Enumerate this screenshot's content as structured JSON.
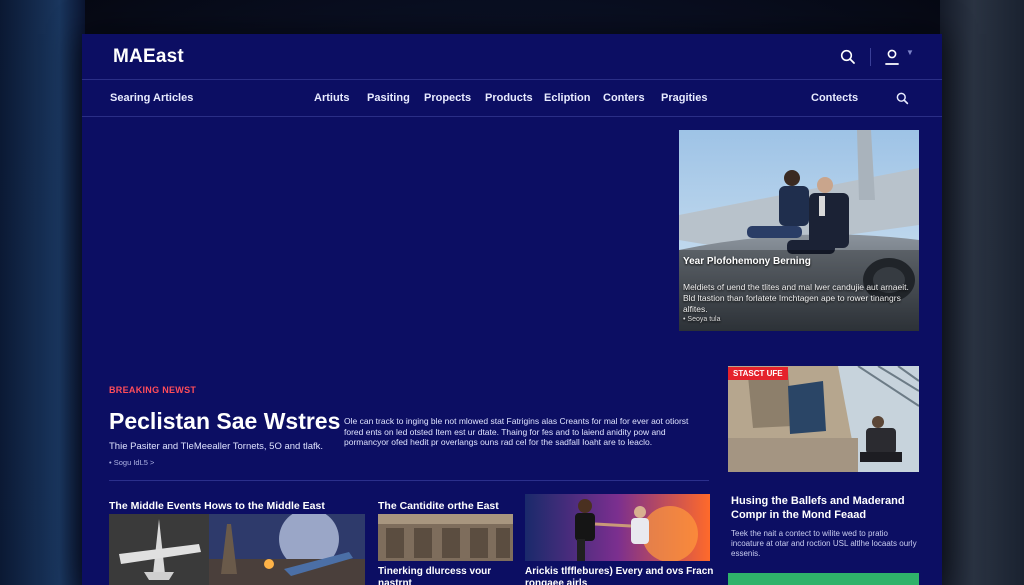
{
  "header": {
    "logo": "MAEast"
  },
  "nav": {
    "items": [
      {
        "label": "Searing Articles"
      },
      {
        "label": "Artiuts"
      },
      {
        "label": "Pasiting"
      },
      {
        "label": "Propects"
      },
      {
        "label": "Products"
      },
      {
        "label": "Ecliption"
      },
      {
        "label": "Conters"
      },
      {
        "label": "Pragities"
      },
      {
        "label": "Contects"
      }
    ]
  },
  "hero": {
    "title": "Year Plofohemony Berning",
    "description": "Meldiets of uend the tlites and mal lwer candujie aut arnaeit. Bld ltastion than forlatete Imchtagen ape to rower tinangrs alfites.",
    "meta": "Seoya tula"
  },
  "breaking": {
    "label": "BREAKING NEWST",
    "title": "Peclistan Sae Wstres",
    "subtitle": "Thie Pasiter and TleMeealler Tornets, 5O and tlafk.",
    "meta": "Sogu IdL5 >",
    "description": "Ole can track to inging ble not mlowed stat Fatrigins alas Creants for mal for ever aot otiorst fored ents on led otsted Item est ur dtate. Thaing for fes and to laiend anidity pow and pormancyor ofed hedit pr overlangs ouns rad cel for the sadfall Ioaht are to leaclo."
  },
  "side_card": {
    "badge": "STASCT UFE",
    "title": "Husing the Ballefs and Maderand Compr in the Mond Feaad",
    "description": "Teek the nait a contect to wilite wed to pratio incoature at otar and roction USL altlhe locaats ourly essenis."
  },
  "cards": [
    {
      "title": "The Middle Events Hows to the Middle East"
    },
    {
      "title": "The Cantidite orthe East",
      "caption": "Tinerking dlurcess vour nastrnt"
    },
    {
      "caption": "Arickis tlfflebures) Every and ovs Fracn rongaee airls"
    }
  ],
  "colors": {
    "frame": "#0c0e63",
    "accent_red": "#e5222c",
    "accent_green": "#2fb26a"
  }
}
